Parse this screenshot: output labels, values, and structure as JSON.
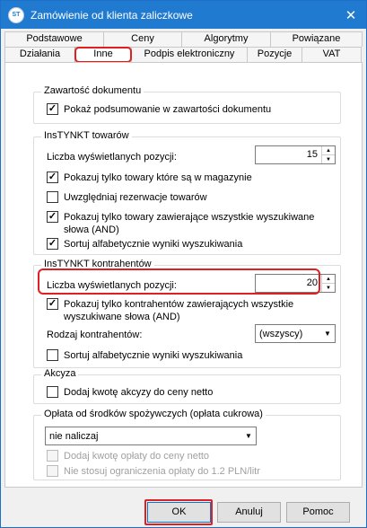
{
  "window": {
    "title": "Zamówienie od klienta zaliczkowe",
    "app_icon_text": "ST",
    "close_glyph": "✕"
  },
  "tabs": {
    "row1": [
      "Podstawowe",
      "Ceny",
      "Algorytmy",
      "Powiązane"
    ],
    "row2": [
      "Działania",
      "Inne",
      "Podpis elektroniczny",
      "Pozycje",
      "VAT"
    ],
    "active": "Inne"
  },
  "groups": {
    "document": {
      "legend": "Zawartość dokumentu",
      "show_summary": {
        "label": "Pokaż podsumowanie w zawartości dokumentu",
        "checked": true
      }
    },
    "instynkt_goods": {
      "legend": "InsTYNKT towarów",
      "count_label": "Liczba wyświetlanych pozycji:",
      "count_value": "15",
      "options": [
        {
          "label": "Pokazuj tylko towary które są w magazynie",
          "checked": true
        },
        {
          "label": "Uwzględniaj rezerwacje towarów",
          "checked": false
        },
        {
          "label": "Pokazuj tylko towary zawierające wszystkie wyszukiwane słowa (AND)",
          "checked": true
        },
        {
          "label": "Sortuj alfabetycznie wyniki wyszukiwania",
          "checked": true
        }
      ]
    },
    "instynkt_contractors": {
      "legend": "InsTYNKT kontrahentów",
      "count_label": "Liczba wyświetlanych pozycji:",
      "count_value": "20",
      "option_and": {
        "label": "Pokazuj tylko kontrahentów zawierających wszystkie wyszukiwane słowa (AND)",
        "checked": true
      },
      "type_label": "Rodzaj kontrahentów:",
      "type_value": "(wszyscy)",
      "option_sort": {
        "label": "Sortuj alfabetycznie wyniki wyszukiwania",
        "checked": false
      }
    },
    "excise": {
      "legend": "Akcyza",
      "add_excise": {
        "label": "Dodaj kwotę akcyzy do ceny netto",
        "checked": false
      }
    },
    "sugar_fee": {
      "legend": "Opłata od środków spożywczych (opłata cukrowa)",
      "mode_value": "nie naliczaj",
      "add_fee": {
        "label": "Dodaj kwotę opłaty do ceny netto",
        "checked": false
      },
      "no_limit": {
        "label": "Nie stosuj ograniczenia opłaty do 1.2 PLN/litr",
        "checked": false
      }
    }
  },
  "buttons": {
    "ok": "OK",
    "cancel": "Anuluj",
    "help": "Pomoc"
  },
  "colors": {
    "titlebar": "#1f7ad0",
    "highlight": "#e02020"
  }
}
